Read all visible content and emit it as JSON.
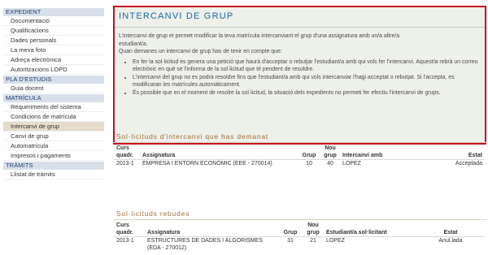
{
  "sidebar": {
    "sections": [
      {
        "title": "EXPEDIENT",
        "items": [
          "Documentació",
          "Qualificacions",
          "Dades personals",
          "La meva foto",
          "Adreça electrònica",
          "Autoritzacions LOPD"
        ]
      },
      {
        "title": "PLA D'ESTUDIS",
        "items": [
          "Guia docent"
        ]
      },
      {
        "title": "MATRÍCULA",
        "items": [
          "Requeriments del sistema",
          "Condicions de matrícula",
          "Intercanvi de grup",
          "Canvi de grup",
          "Automatrícula",
          "Impresos i pagaments"
        ]
      },
      {
        "title": "TRÀMITS",
        "items": [
          "Llistat de tràmits"
        ]
      }
    ],
    "active_item": "Intercanvi de grup"
  },
  "panel": {
    "title": "INTERCANVI DE GRUP",
    "intro_line1": "L'intercanvi de grup et permet modificar la teva matrícula intercanviant el grup d'una assignatura amb un/a altre/a",
    "intro_line2": "estudiant/a.",
    "intro_line3": "Quan demanes un intercanvi de grup has de tenir en compte que:",
    "bullets": [
      "En fer la sol·licitud es genera una petició que haurà d'acceptar o rebutjar l'estudiant/a amb qui vols fer l'intercanvi. Aquest/a rebrà un correu electrònic en què se l'informa de la sol·licitud que té pendent de resoldre.",
      "L'intercanvi del grup no es podrà resoldre fins que l'estudiant/a amb qui vols intercanviar l'hagi acceptat o rebutjat. Si l'accepta, es modificaran les matrícules automàticament.",
      "És possible que en el moment de resolre la sol·licitud, la situació dels expedients no permeti fer efectiu l'intercanvi de grups."
    ]
  },
  "sent": {
    "heading": "Sol·licituds d'intercanvi que has demanat",
    "columns": [
      "Curs quadr.",
      "Assignatura",
      "Grup",
      "Nou grup",
      "Intercanvi amb",
      "Estat"
    ],
    "rows": [
      [
        "2013-1",
        "EMPRESA I ENTORN ECONÒMIC (EEE - 270014)",
        "10",
        "40",
        "LOPEZ",
        "Acceptada"
      ]
    ]
  },
  "received": {
    "heading": "Sol·licituds rebudes",
    "columns": [
      "Curs quadr.",
      "Assignatura",
      "Grup",
      "Nou grup",
      "Estudiant/a sol·licitant",
      "Estat"
    ],
    "rows": [
      [
        "2013-1",
        "ESTRUCTURES DE DADES I ALGORISMES (EDA - 270012)",
        "31",
        "21",
        "LOPEZ",
        "Anul.lada"
      ]
    ]
  }
}
